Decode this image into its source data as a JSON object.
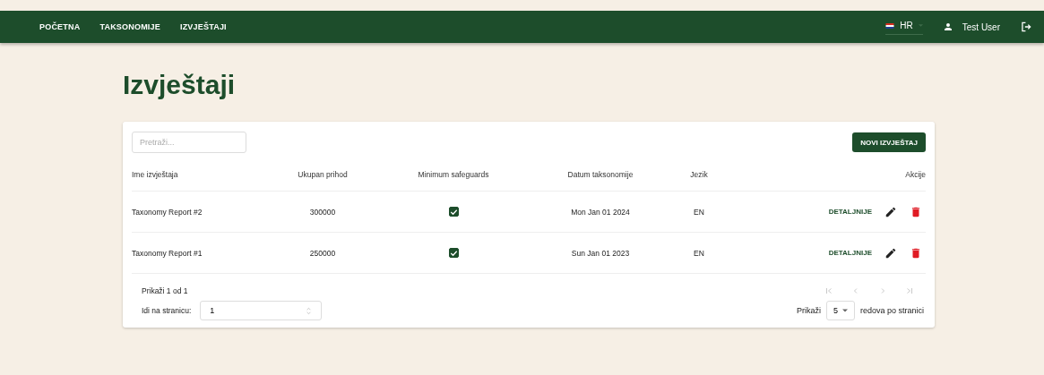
{
  "nav": {
    "items": [
      {
        "label": "POČETNA"
      },
      {
        "label": "TAKSONOMIJE"
      },
      {
        "label": "IZVJEŠTAJI"
      }
    ],
    "language": "HR",
    "user": "Test User"
  },
  "page_title": "Izvještaji",
  "search": {
    "placeholder": "Pretraži..."
  },
  "new_button": "NOVI IZVJEŠTAJ",
  "table": {
    "columns": [
      "Ime izvještaja",
      "Ukupan prihod",
      "Minimum safeguards",
      "Datum taksonomije",
      "Jezik",
      "Akcije"
    ],
    "rows": [
      {
        "name": "Taxonomy Report #2",
        "revenue": "300000",
        "safeguards": true,
        "date": "Mon Jan 01 2024",
        "language": "EN",
        "details": "DETALJNIJE"
      },
      {
        "name": "Taxonomy Report #1",
        "revenue": "250000",
        "safeguards": true,
        "date": "Sun Jan 01 2023",
        "language": "EN",
        "details": "DETALJNIJE"
      }
    ]
  },
  "pagination": {
    "summary": "Prikaži 1 od 1",
    "goto_label": "Idi na stranicu:",
    "goto_value": "1",
    "buttons": [
      {
        "kind": "first",
        "disabled": true
      },
      {
        "kind": "prev",
        "disabled": true
      },
      {
        "kind": "next",
        "disabled": true
      },
      {
        "kind": "last",
        "disabled": true
      }
    ],
    "show_label": "Prikaži",
    "page_size": "5",
    "rows_label": "redova po stranici"
  }
}
